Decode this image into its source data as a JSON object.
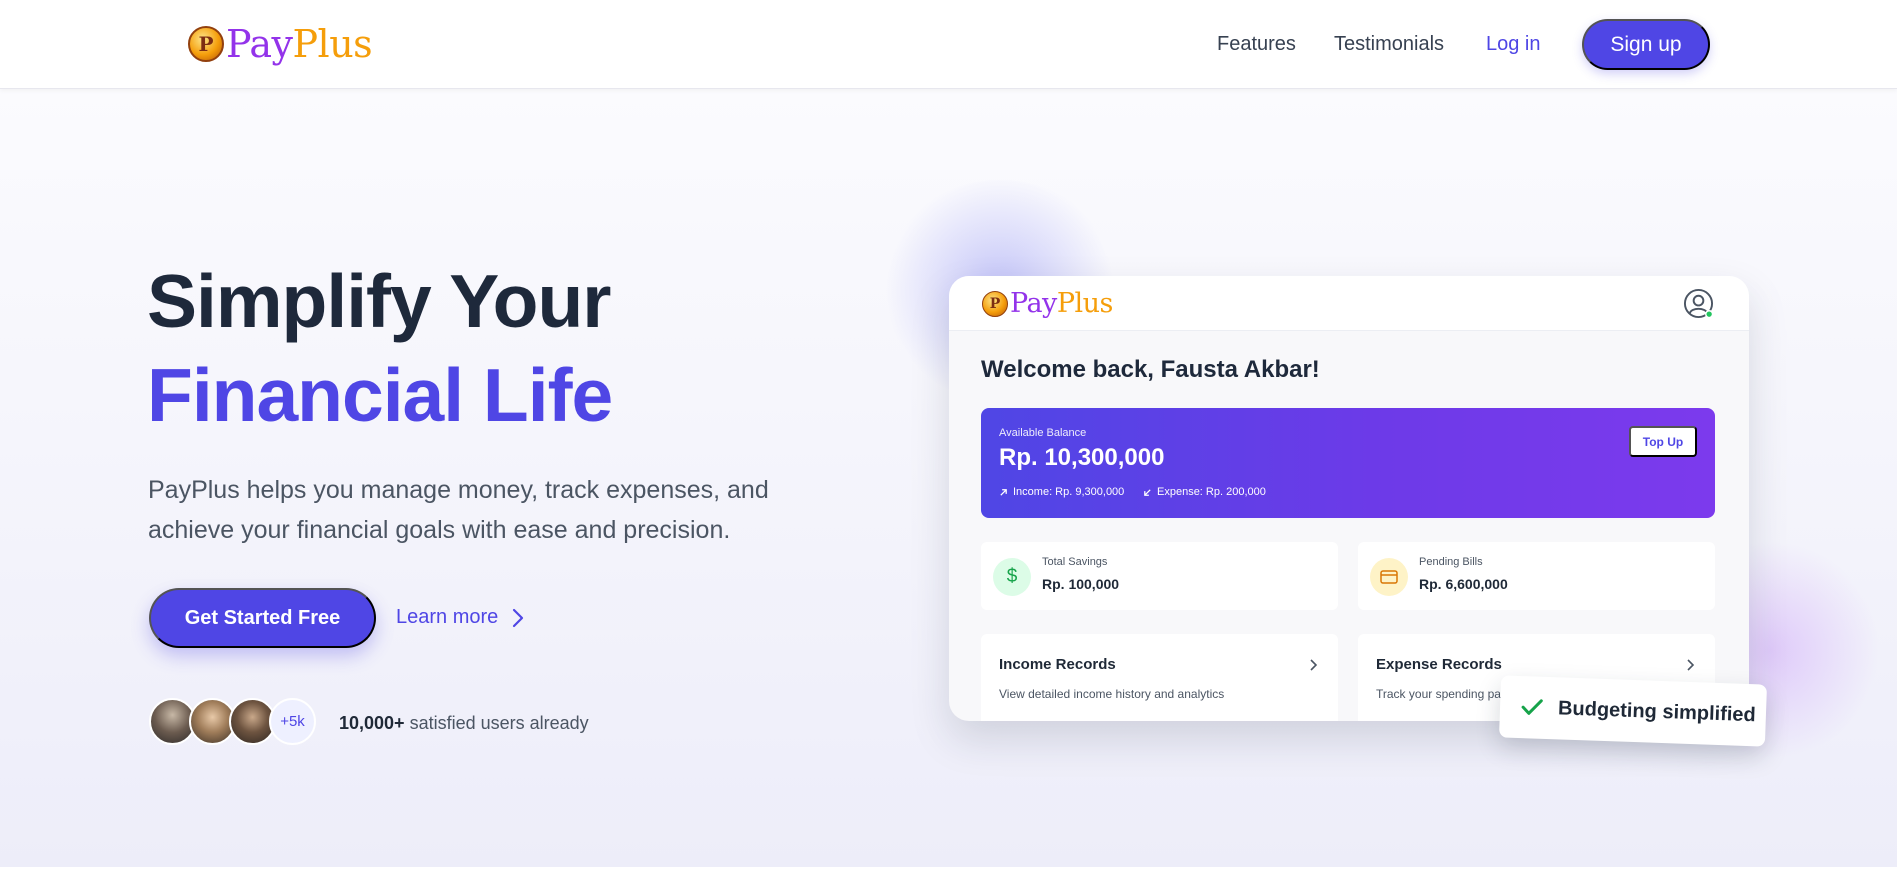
{
  "brand": {
    "pay": "Pay",
    "plus": "Plus",
    "coin_glyph": "P"
  },
  "nav": {
    "features": "Features",
    "testimonials": "Testimonials",
    "login": "Log in",
    "signup": "Sign up"
  },
  "hero": {
    "headline_line1": "Simplify Your",
    "headline_line2": "Financial Life",
    "subtext": "PayPlus helps you manage money, track expenses, and achieve your financial goals with ease and precision.",
    "cta_primary": "Get Started Free",
    "cta_secondary": "Learn more",
    "avatar_more": "+5k",
    "users_count": "10,000+",
    "users_suffix": " satisfied users already"
  },
  "dashboard": {
    "welcome": "Welcome back, Fausta Akbar!",
    "balance_label": "Available Balance",
    "balance_amount": "Rp. 10,300,000",
    "income_summary": "Income: Rp. 9,300,000",
    "expense_summary": "Expense: Rp. 200,000",
    "topup": "Top Up",
    "savings_label": "Total Savings",
    "savings_value": "Rp. 100,000",
    "savings_icon_glyph": "$",
    "bills_label": "Pending Bills",
    "bills_value": "Rp. 6,600,000",
    "income_records_title": "Income Records",
    "income_records_desc": "View detailed income history and analytics",
    "expense_records_title": "Expense Records",
    "expense_records_desc": "Track your spending patterns"
  },
  "toast": {
    "text": "Budgeting simplified"
  },
  "icons": {
    "learn_more": "chevron-right-icon",
    "user": "user-circle-icon",
    "savings": "dollar-icon",
    "bills": "credit-card-icon",
    "income_arrow": "arrow-up-right-icon",
    "expense_arrow": "arrow-down-left-icon",
    "toast": "check-icon"
  },
  "colors": {
    "primary": "#4f46e5",
    "brand_pay": "#9333ea",
    "brand_plus": "#f59e0b",
    "heading_dark": "#1e293b",
    "success": "#16a34a"
  }
}
